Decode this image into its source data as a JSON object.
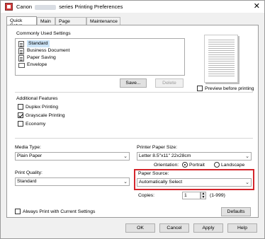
{
  "window": {
    "title_prefix": "Canon",
    "title_suffix": "series Printing Preferences",
    "close_glyph": "✕"
  },
  "tabs": [
    "Quick Setup",
    "Main",
    "Page Setup",
    "Maintenance"
  ],
  "commonly_used": {
    "heading": "Commonly Used Settings",
    "items": [
      "Standard",
      "Business Document",
      "Paper Saving",
      "Envelope"
    ],
    "save_label": "Save...",
    "delete_label": "Delete"
  },
  "preview_before_printing": {
    "label": "Preview before printing",
    "checked": false
  },
  "additional_features": {
    "heading": "Additional Features",
    "items": [
      {
        "label": "Duplex Printing",
        "checked": false
      },
      {
        "label": "Grayscale Printing",
        "checked": true
      },
      {
        "label": "Economy",
        "checked": false
      }
    ]
  },
  "media_type": {
    "label": "Media Type:",
    "value": "Plain Paper"
  },
  "printer_paper_size": {
    "label": "Printer Paper Size:",
    "value": "Letter 8.5\"x11\" 22x28cm"
  },
  "orientation": {
    "label": "Orientation:",
    "portrait": "Portrait",
    "landscape": "Landscape",
    "selected": "Portrait"
  },
  "print_quality": {
    "label": "Print Quality:",
    "value": "Standard"
  },
  "paper_source": {
    "label": "Paper Source:",
    "value": "Automatically Select"
  },
  "copies": {
    "label": "Copies:",
    "value": "1",
    "range": "(1-999)"
  },
  "always_print": {
    "label": "Always Print with Current Settings",
    "checked": false
  },
  "defaults_label": "Defaults",
  "footer": {
    "ok": "OK",
    "cancel": "Cancel",
    "apply": "Apply",
    "help": "Help"
  },
  "colors": {
    "highlight": "#d4262c",
    "selected_row": "#cce4f7"
  }
}
